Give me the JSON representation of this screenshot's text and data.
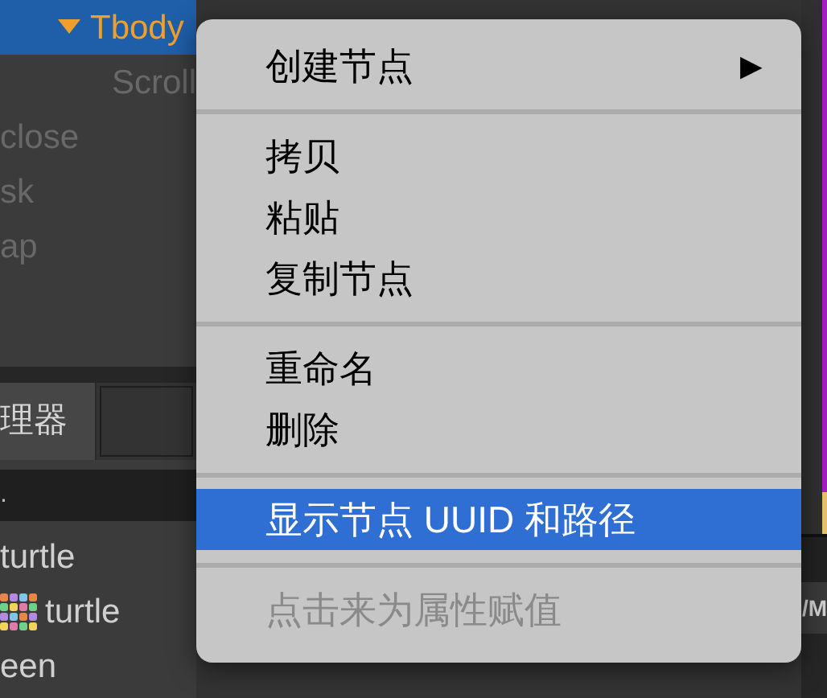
{
  "hierarchy": {
    "nodes": [
      {
        "label": "Tbody",
        "selected": true,
        "expanded": true,
        "active": true
      },
      {
        "label": "Scroll",
        "selected": false,
        "active": false
      },
      {
        "label": "close",
        "selected": false,
        "active": false
      },
      {
        "label": "sk",
        "selected": false,
        "active": false
      },
      {
        "label": "ap",
        "selected": false,
        "active": false
      }
    ]
  },
  "assets_tab": {
    "label": "理器"
  },
  "search": {
    "value": "."
  },
  "assets": [
    {
      "label": "turtle",
      "kind": "text"
    },
    {
      "label": "turtle",
      "kind": "sprite"
    },
    {
      "label": "een",
      "kind": "text"
    }
  ],
  "right_panel": {
    "label": "/M"
  },
  "context_menu": [
    {
      "kind": "item",
      "label": "创建节点",
      "submenu": "▶",
      "selected": false,
      "disabled": false
    },
    {
      "kind": "separator"
    },
    {
      "kind": "item",
      "label": "拷贝",
      "selected": false,
      "disabled": false
    },
    {
      "kind": "item",
      "label": "粘贴",
      "selected": false,
      "disabled": false
    },
    {
      "kind": "item",
      "label": "复制节点",
      "selected": false,
      "disabled": false
    },
    {
      "kind": "separator"
    },
    {
      "kind": "item",
      "label": "重命名",
      "selected": false,
      "disabled": false
    },
    {
      "kind": "item",
      "label": "删除",
      "selected": false,
      "disabled": false
    },
    {
      "kind": "separator"
    },
    {
      "kind": "item",
      "label": "显示节点 UUID 和路径",
      "selected": true,
      "disabled": false
    },
    {
      "kind": "separator"
    },
    {
      "kind": "item",
      "label": "点击来为属性赋值",
      "selected": false,
      "disabled": true
    }
  ]
}
